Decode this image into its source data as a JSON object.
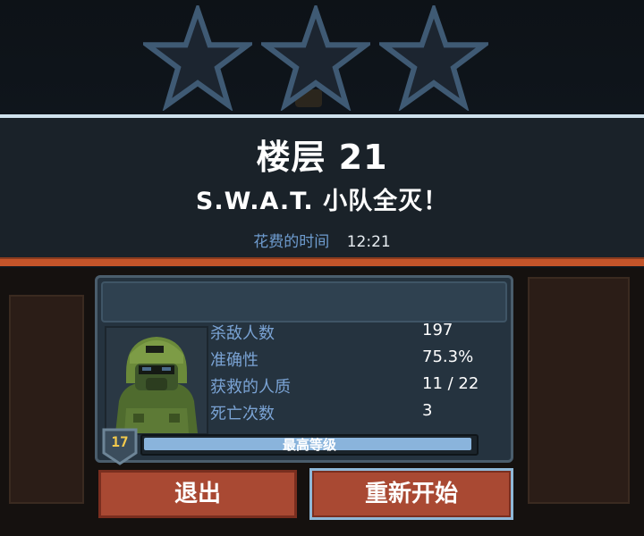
{
  "header": {
    "floor_title": "楼层 21",
    "result": "S.W.A.T. 小队全灭！",
    "time_label": "花费的时间",
    "time_value": "12:21",
    "stars_total": 3,
    "stars_earned": 0
  },
  "stats": [
    {
      "label": "杀敌人数",
      "value": "197"
    },
    {
      "label": "准确性",
      "value": "75.3%"
    },
    {
      "label": "获救的人质",
      "value": "11 / 22"
    },
    {
      "label": "死亡次数",
      "value": "3"
    }
  ],
  "level": {
    "number": "17",
    "progress_label": "最高等级",
    "progress": 1.0
  },
  "buttons": {
    "quit": "退出",
    "restart": "重新开始"
  },
  "colors": {
    "accent": "#a94933",
    "label_blue": "#7aa3d4",
    "star_outline": "#3f5a74",
    "level_gold": "#f2c94c"
  }
}
